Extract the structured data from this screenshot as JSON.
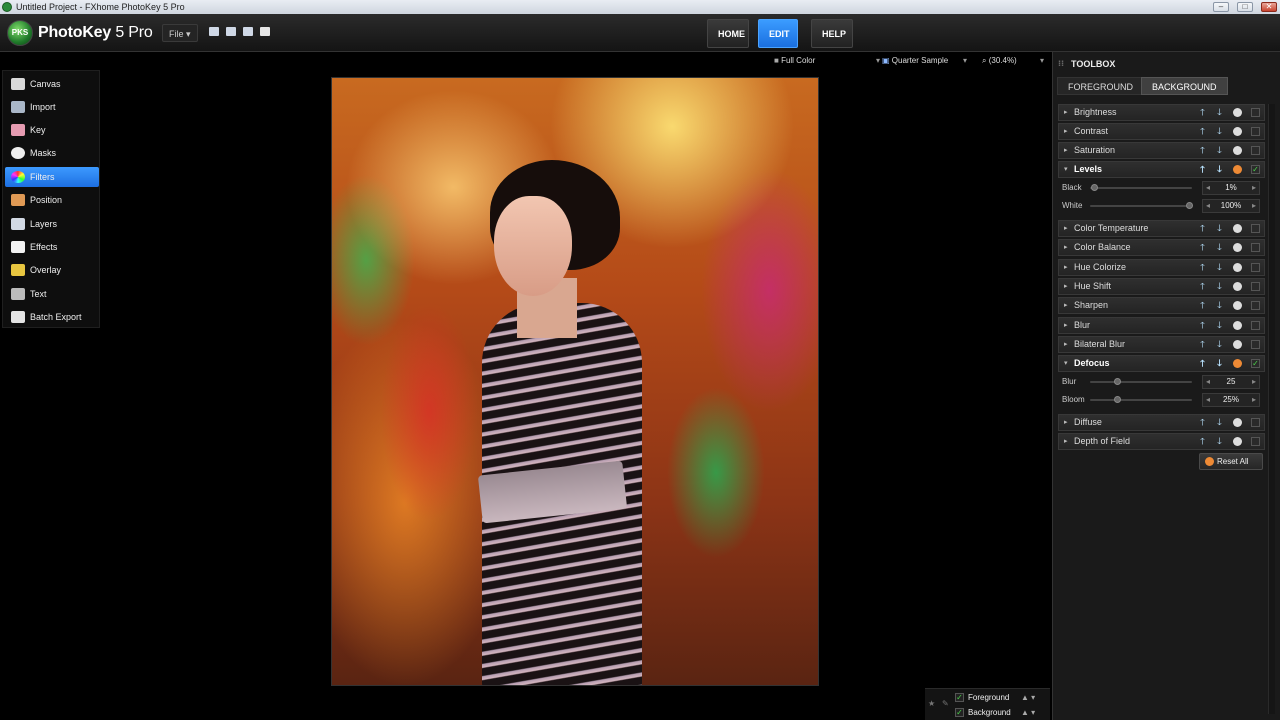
{
  "window": {
    "title": "Untitled Project - FXhome PhotoKey 5 Pro",
    "min_glyph": "–",
    "max_glyph": "□",
    "close_glyph": "✕"
  },
  "header": {
    "logo_text": "PKS",
    "app_name": "PhotoKey",
    "app_version": "5 Pro",
    "file_menu": "File ▾",
    "nav": {
      "home": "HOME",
      "edit": "EDIT",
      "help": "HELP"
    },
    "active_nav": "EDIT"
  },
  "sidebar": {
    "items": [
      {
        "label": "Canvas",
        "icon": "canvas-icon"
      },
      {
        "label": "Import",
        "icon": "import-icon"
      },
      {
        "label": "Key",
        "icon": "key-icon"
      },
      {
        "label": "Masks",
        "icon": "masks-icon"
      },
      {
        "label": "Filters",
        "icon": "filters-icon"
      },
      {
        "label": "Position",
        "icon": "position-icon"
      },
      {
        "label": "Layers",
        "icon": "layers-icon"
      },
      {
        "label": "Effects",
        "icon": "effects-icon"
      },
      {
        "label": "Overlay",
        "icon": "overlay-icon"
      },
      {
        "label": "Text",
        "icon": "text-icon"
      },
      {
        "label": "Batch Export",
        "icon": "batch-export-icon"
      }
    ],
    "active": "Filters"
  },
  "viewer": {
    "color_mode": "Full Color",
    "sample": "Quarter Sample",
    "zoom": "(30.4%)"
  },
  "layers": {
    "foreground": "Foreground",
    "background": "Background"
  },
  "toolbox": {
    "title": "TOOLBOX",
    "tabs": {
      "foreground": "FOREGROUND",
      "background": "BACKGROUND"
    },
    "active_tab": "BACKGROUND",
    "filters": {
      "brightness": "Brightness",
      "contrast": "Contrast",
      "saturation": "Saturation",
      "levels": "Levels",
      "color_temperature": "Color Temperature",
      "color_balance": "Color Balance",
      "hue_colorize": "Hue Colorize",
      "hue_shift": "Hue Shift",
      "sharpen": "Sharpen",
      "blur": "Blur",
      "bilateral_blur": "Bilateral Blur",
      "defocus": "Defocus",
      "diffuse": "Diffuse",
      "depth_of_field": "Depth of Field"
    },
    "levels_params": {
      "black_label": "Black",
      "black_value": "1%",
      "black_level": 0.01,
      "white_label": "White",
      "white_value": "100%",
      "white_level": 1.0
    },
    "defocus_params": {
      "blur_label": "Blur",
      "blur_value": "25",
      "blur_level": 0.25,
      "bloom_label": "Bloom",
      "bloom_value": "25%",
      "bloom_level": 0.25
    },
    "reset_all": "Reset All"
  }
}
